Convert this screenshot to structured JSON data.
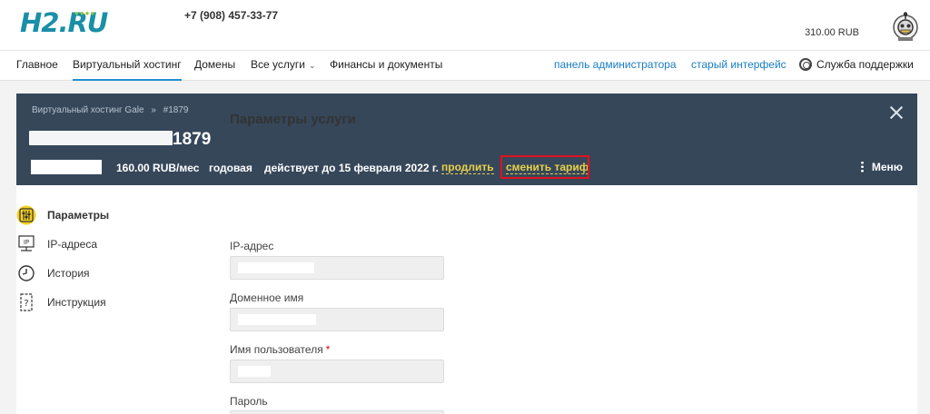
{
  "header": {
    "logo_text": "H2.RU",
    "phone": "+7 (908) 457-33-77",
    "balance": "310.00 RUB",
    "avatar_icon": "gear-robot-avatar-icon"
  },
  "nav": {
    "items": [
      "Главное",
      "Виртуальный хостинг",
      "Домены",
      "Все услуги",
      "Финансы и документы"
    ],
    "right_items": [
      "панель администратора",
      "старый интерфейс",
      "Служба поддержки"
    ],
    "active_color": "#1f8fd1"
  },
  "service": {
    "breadcrumb": [
      "Виртуальный хостинг Gale",
      "»",
      "#1879"
    ],
    "title_number": "1879",
    "price": "160.00 RUB/мес",
    "period": "годовая",
    "valid_until": "действует до 15 февраля 2022 г.",
    "renew_link": "продлить",
    "change_plan_link": "сменить тариф",
    "menu_label": "Меню",
    "header_color": "#36475a",
    "highlight_color": "#e0121e"
  },
  "sidebar": {
    "items": [
      {
        "label": "Параметры",
        "icon": "sliders-icon"
      },
      {
        "label": "IP-адреса",
        "icon": "ip-icon"
      },
      {
        "label": "История",
        "icon": "clock-icon"
      },
      {
        "label": "Инструкция",
        "icon": "help-doc-icon"
      }
    ]
  },
  "form": {
    "title": "Параметры услуги",
    "fields": [
      {
        "label": "IP-адрес"
      },
      {
        "label": "Доменное имя"
      },
      {
        "label": "Имя пользователя",
        "required_mark": "*"
      },
      {
        "label": "Пароль"
      }
    ]
  }
}
